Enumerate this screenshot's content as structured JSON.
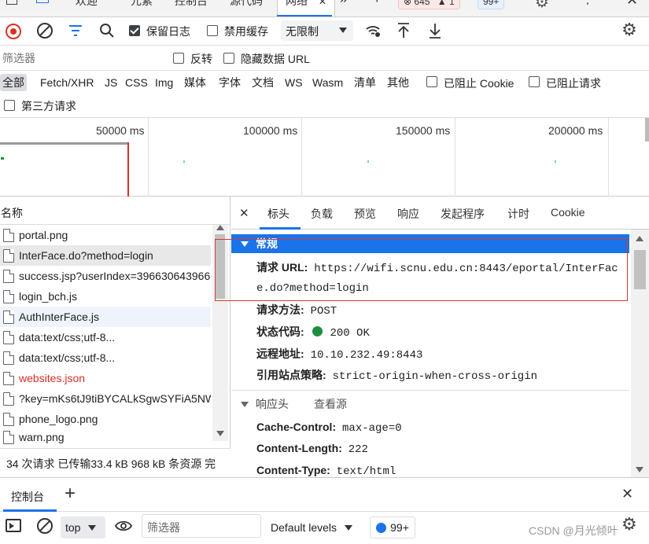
{
  "tabstrip": {
    "tabs": [
      "欢迎",
      "元素",
      "控制台",
      "源代码",
      "网络"
    ],
    "active_tab": "网络",
    "close": "✕",
    "more": "»",
    "plus": "+",
    "errors_badge": "⊗ 645",
    "warnings_badge": "▲ 1",
    "issues_badge": "99+"
  },
  "toolbar": {
    "preserve_log_label": "保留日志",
    "preserve_log_checked": true,
    "disable_cache_label": "禁用缓存",
    "disable_cache_checked": false,
    "throttle_value": "无限制"
  },
  "filter": {
    "placeholder": "筛选器",
    "invert_label": "反转",
    "hide_data_urls_label": "隐藏数据 URL"
  },
  "types": {
    "items": [
      "全部",
      "Fetch/XHR",
      "JS",
      "CSS",
      "Img",
      "媒体",
      "字体",
      "文档",
      "WS",
      "Wasm",
      "清单",
      "其他"
    ],
    "active": "全部",
    "blocked_cookies_label": "已阻止 Cookie",
    "blocked_requests_label": "已阻止请求",
    "third_party_label": "第三方请求"
  },
  "timeline": {
    "labels": [
      "50000 ms",
      "100000 ms",
      "150000 ms",
      "200000 ms"
    ]
  },
  "requests": {
    "column_name": "名称",
    "rows": [
      {
        "name": "portal.png",
        "error": false
      },
      {
        "name": "InterFace.do?method=login",
        "error": false
      },
      {
        "name": "success.jsp?userIndex=396630643966",
        "error": false
      },
      {
        "name": "login_bch.js",
        "error": false
      },
      {
        "name": "AuthInterFace.js",
        "error": false
      },
      {
        "name": "data:text/css;utf-8...",
        "error": false
      },
      {
        "name": "data:text/css;utf-8...",
        "error": false
      },
      {
        "name": "websites.json",
        "error": true
      },
      {
        "name": "?key=mKs6tJ9tiBYCALkSgwSYFiA5NW",
        "error": false
      },
      {
        "name": "phone_logo.png",
        "error": false
      },
      {
        "name": "warn.png",
        "error": false
      }
    ]
  },
  "status": {
    "text": "34 次请求  已传输33.4 kB  968 kB 条资源  完"
  },
  "detail": {
    "close": "✕",
    "tabs": [
      "标头",
      "负载",
      "预览",
      "响应",
      "发起程序",
      "计时",
      "Cookie"
    ],
    "active_tab": "标头",
    "general_title": "常规",
    "request_url_key": "请求 URL:",
    "request_url_line1": "https://wifi.scnu.edu.cn:8443/eportal/InterFac",
    "request_url_line2": "e.do?method=login",
    "method_key": "请求方法:",
    "method_value": "POST",
    "status_key": "状态代码:",
    "status_value": "200 OK",
    "remote_key": "远程地址:",
    "remote_value": "10.10.232.49:8443",
    "referrer_key": "引用站点策略:",
    "referrer_value": "strict-origin-when-cross-origin",
    "response_headers_title": "响应头",
    "view_source": "查看源",
    "cache_control_key": "Cache-Control:",
    "cache_control_value": "max-age=0",
    "content_length_key": "Content-Length:",
    "content_length_value": "222",
    "content_type_key": "Content-Type:",
    "content_type_value": "text/html"
  },
  "drawer": {
    "tab_label": "控制台",
    "plus": "+",
    "close": "✕",
    "context": "top",
    "filter_placeholder": "筛选器",
    "levels": "Default levels",
    "issues_badge": "99+",
    "watermark": "CSDN @月光倾叶"
  },
  "colors": {
    "accent": "#1a73e8",
    "record_red": "#d93025",
    "highlight_box": "#d23b3b",
    "status_green": "#1e8e3e"
  }
}
